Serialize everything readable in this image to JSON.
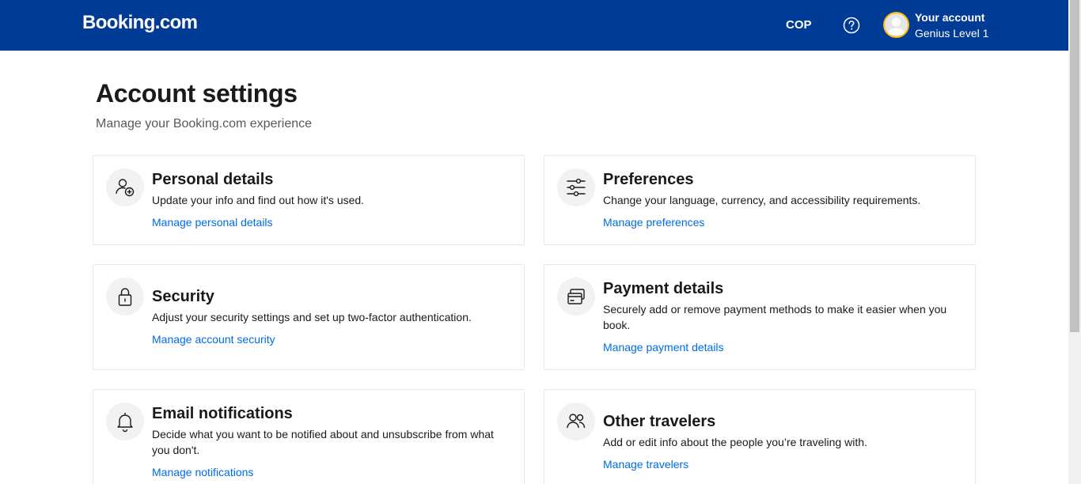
{
  "header": {
    "logo": "Booking.com",
    "currency": "COP",
    "account_name": "Your account",
    "account_level": "Genius Level 1"
  },
  "page": {
    "title": "Account settings",
    "subtitle": "Manage your Booking.com experience"
  },
  "cards": [
    {
      "icon": "person-add-icon",
      "title": "Personal details",
      "description": "Update your info and find out how it's used.",
      "link": "Manage personal details"
    },
    {
      "icon": "sliders-icon",
      "title": "Preferences",
      "description": "Change your language, currency, and accessibility requirements.",
      "link": "Manage preferences"
    },
    {
      "icon": "lock-icon",
      "title": "Security",
      "description": "Adjust your security settings and set up two-factor authentication.",
      "link": "Manage account security"
    },
    {
      "icon": "credit-card-icon",
      "title": "Payment details",
      "description": "Securely add or remove payment methods to make it easier when you book.",
      "link": "Manage payment details"
    },
    {
      "icon": "bell-icon",
      "title": "Email notifications",
      "description": "Decide what you want to be notified about and unsubscribe from what you don't.",
      "link": "Manage notifications"
    },
    {
      "icon": "people-icon",
      "title": "Other travelers",
      "description": "Add or edit info about the people you’re traveling with.",
      "link": "Manage travelers"
    }
  ],
  "colors": {
    "header_bg": "#003b95",
    "link": "#006ce4",
    "avatar_ring": "#febb02"
  }
}
